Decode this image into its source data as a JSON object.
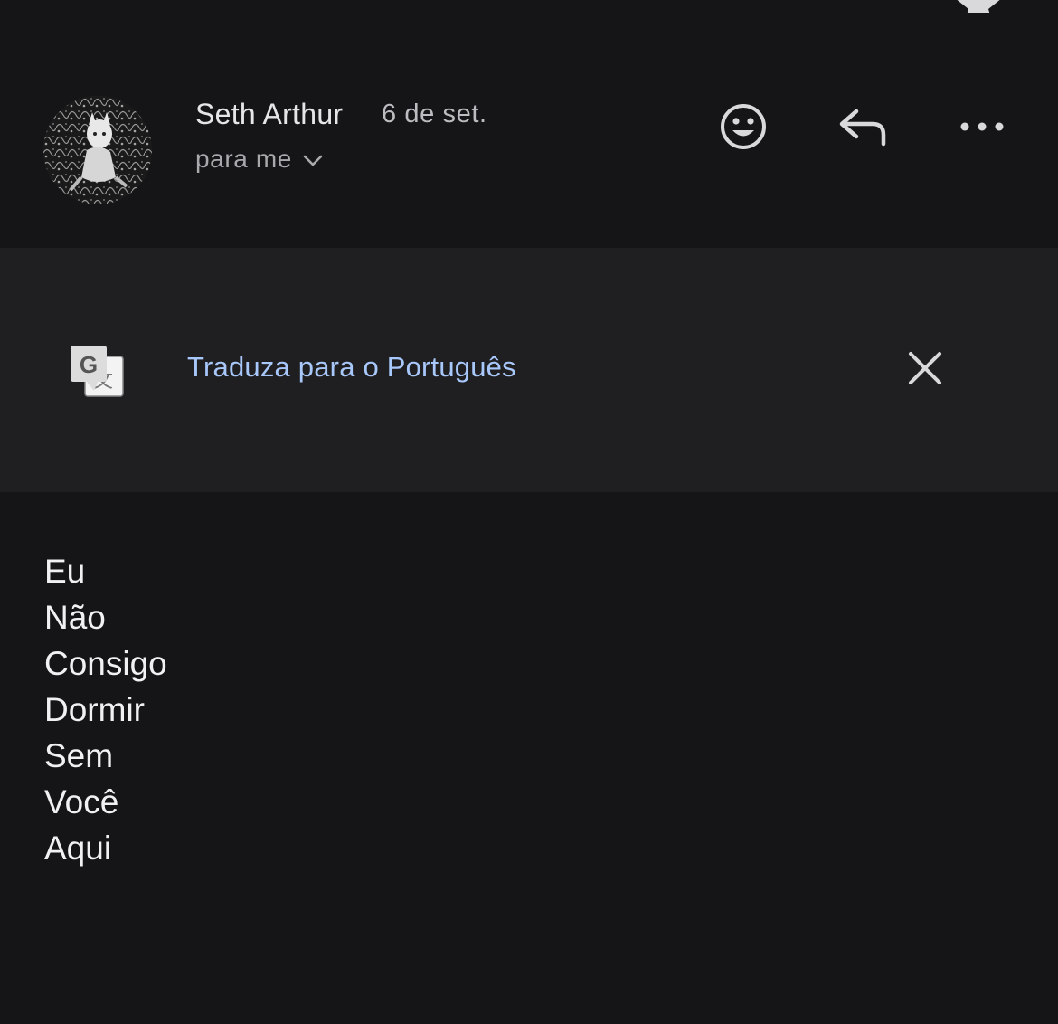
{
  "header": {
    "sender_name": "Seth Arthur",
    "date": "6 de set.",
    "recipient": "para me",
    "icons": {
      "avatar": "avatar-image",
      "recipient_toggle": "chevron-down-icon",
      "emoji": "smiley-face-icon",
      "reply": "reply-arrow-icon",
      "more": "more-horizontal-icon",
      "star": "star-icon"
    }
  },
  "translate_bar": {
    "link_text": "Traduza para o Português",
    "icon": "google-translate-icon",
    "close_icon": "close-icon"
  },
  "message_body": {
    "lines": [
      "Eu",
      "Não",
      "Consigo",
      "Dormir",
      "Sem",
      "Você",
      "Aqui"
    ]
  },
  "colors": {
    "background": "#151517",
    "translate_bar_background": "#1f1f21",
    "link_blue": "#a8c7fa",
    "text_primary": "#f1f1f3",
    "text_secondary": "#a9a9ad"
  }
}
